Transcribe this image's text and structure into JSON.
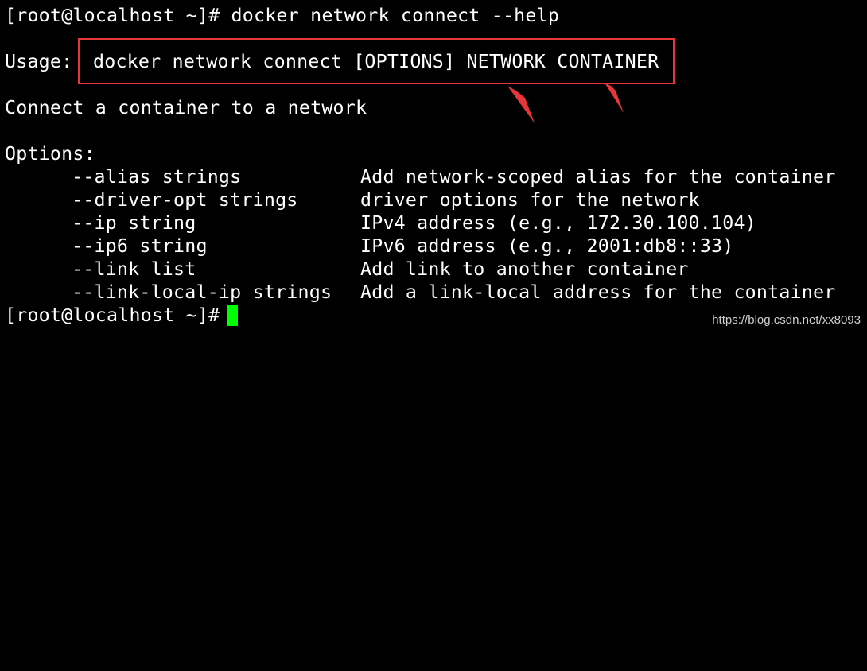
{
  "terminal": {
    "prompt": "[root@localhost ~]#",
    "command": " docker network connect --help",
    "usage_label": "Usage:",
    "usage_text": "docker network connect [OPTIONS] NETWORK CONTAINER",
    "description": "Connect a container to a network",
    "options_label": "Options:",
    "options": [
      {
        "flag": "--alias strings",
        "desc": "Add network-scoped alias for the container"
      },
      {
        "flag": "--driver-opt strings",
        "desc": "driver options for the network"
      },
      {
        "flag": "--ip string",
        "desc": "IPv4 address (e.g., 172.30.100.104)"
      },
      {
        "flag": "--ip6 string",
        "desc": "IPv6 address (e.g., 2001:db8::33)"
      },
      {
        "flag": "--link list",
        "desc": "Add link to another container"
      },
      {
        "flag": "--link-local-ip strings",
        "desc": "Add a link-local address for the container"
      }
    ],
    "final_prompt": "[root@localhost ~]#"
  },
  "annotation": {
    "box_color": "#e8373a",
    "arrow_color": "#e8373a"
  },
  "watermark": "https://blog.csdn.net/xx8093",
  "colors": {
    "background": "#000000",
    "text": "#ffffff",
    "cursor": "#00ff00"
  }
}
